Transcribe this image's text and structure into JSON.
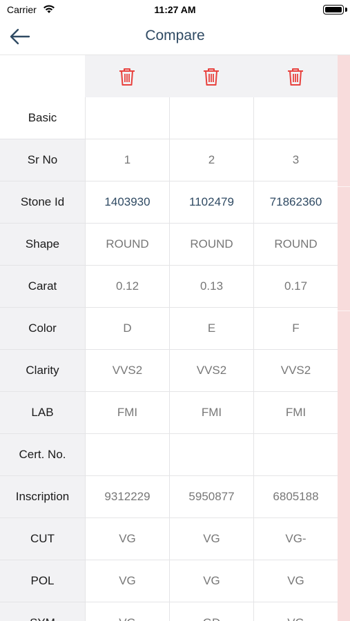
{
  "status": {
    "carrier": "Carrier",
    "time": "11:27 AM"
  },
  "nav": {
    "title": "Compare"
  },
  "colors": {
    "accent": "#2f4a63",
    "trash": "#e8413d",
    "label_bg": "#f2f2f4",
    "strip": "#f8dcdc"
  },
  "section": {
    "basic": "Basic"
  },
  "rows": [
    {
      "label": "Sr No",
      "values": [
        "1",
        "2",
        "3"
      ]
    },
    {
      "label": "Stone Id",
      "values": [
        "1403930",
        "1102479",
        "71862360"
      ]
    },
    {
      "label": "Shape",
      "values": [
        "ROUND",
        "ROUND",
        "ROUND"
      ]
    },
    {
      "label": "Carat",
      "values": [
        "0.12",
        "0.13",
        "0.17"
      ]
    },
    {
      "label": "Color",
      "values": [
        "D",
        "E",
        "F"
      ]
    },
    {
      "label": "Clarity",
      "values": [
        "VVS2",
        "VVS2",
        "VVS2"
      ]
    },
    {
      "label": "LAB",
      "values": [
        "FMI",
        "FMI",
        "FMI"
      ]
    },
    {
      "label": "Cert. No.",
      "values": [
        "",
        "",
        ""
      ]
    },
    {
      "label": "Inscription",
      "values": [
        "9312229",
        "5950877",
        "6805188"
      ]
    },
    {
      "label": "CUT",
      "values": [
        "VG",
        "VG",
        "VG-"
      ]
    },
    {
      "label": "POL",
      "values": [
        "VG",
        "VG",
        "VG"
      ]
    },
    {
      "label": "SYM",
      "values": [
        "VG",
        "GD",
        "VG"
      ]
    }
  ]
}
